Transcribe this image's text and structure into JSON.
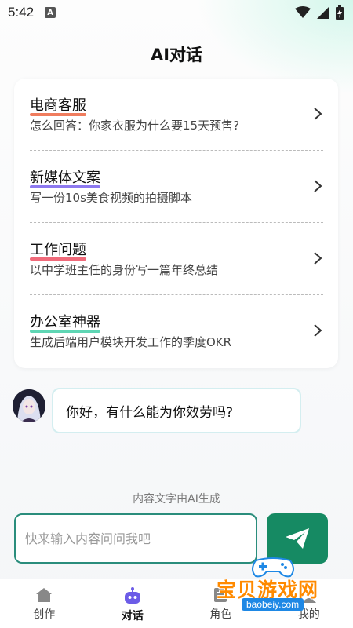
{
  "status": {
    "time": "5:42",
    "app_icon": "A"
  },
  "header": {
    "title": "AI对话"
  },
  "prompts": [
    {
      "title": "电商客服",
      "subtitle": "怎么回答：你家衣服为什么要15天预售?",
      "underline_color": "#f07d5e"
    },
    {
      "title": "新媒体文案",
      "subtitle": "写一份10s美食视频的拍摄脚本",
      "underline_color": "#8e7af0"
    },
    {
      "title": "工作问题",
      "subtitle": "以中学班主任的身份写一篇年终总结",
      "underline_color": "#f06a7a"
    },
    {
      "title": "办公室神器",
      "subtitle": "生成后端用户模块开发工作的季度OKR",
      "underline_color": "#5fd6b4"
    }
  ],
  "chat": {
    "greeting": "你好，有什么能为你效劳吗?"
  },
  "disclaimer": "内容文字由AI生成",
  "input": {
    "placeholder": "快来输入内容问问我吧",
    "value": ""
  },
  "nav": {
    "items": [
      {
        "label": "创作",
        "icon": "home-icon"
      },
      {
        "label": "对话",
        "icon": "robot-icon",
        "active": true
      },
      {
        "label": "角色",
        "icon": "role-icon"
      },
      {
        "label": "我的",
        "icon": "profile-icon"
      }
    ]
  },
  "watermark": {
    "text": "宝贝游戏网",
    "url": "baobeiy.com"
  },
  "colors": {
    "accent": "#168a63",
    "input_border": "#2a8d7c",
    "bubble_border": "#d4eef0"
  }
}
